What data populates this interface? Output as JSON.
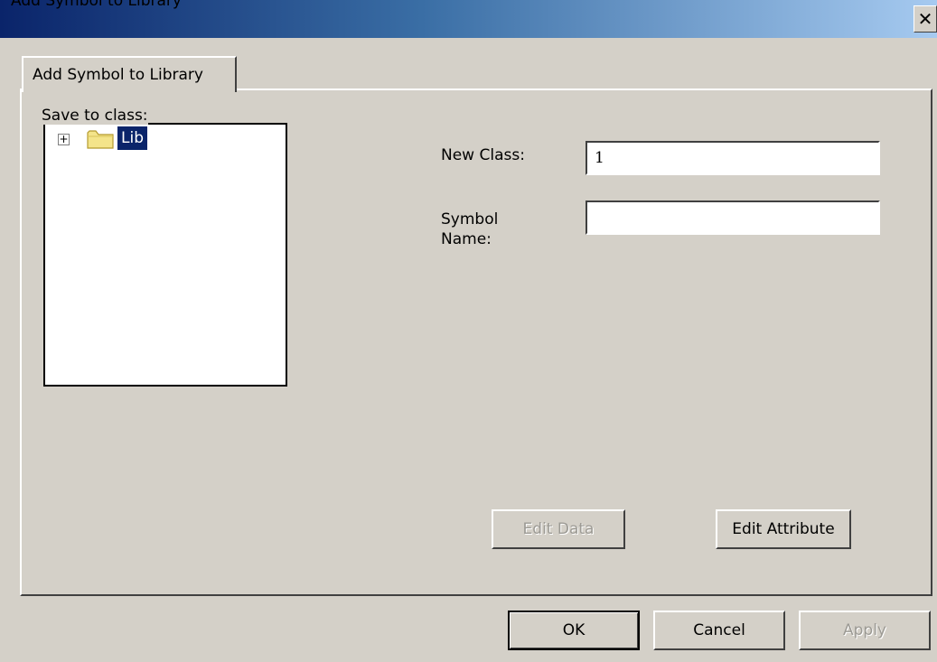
{
  "window": {
    "title": "Add Symbol to Library",
    "close_icon": "close-icon"
  },
  "tabs": [
    {
      "label": "Add Symbol to Library",
      "active": true
    }
  ],
  "tree_group": {
    "label": "Save to class:",
    "nodes": [
      {
        "label": "Lib",
        "expander": "+",
        "icon": "folder-icon",
        "selected": true
      }
    ]
  },
  "form": {
    "new_class_label": "New Class:",
    "new_class_value": "1",
    "symbol_name_label": "Symbol Name:",
    "symbol_name_value": ""
  },
  "buttons": {
    "edit_data": "Edit Data",
    "edit_attribute": "Edit Attribute",
    "ok": "OK",
    "cancel": "Cancel",
    "apply": "Apply"
  },
  "colors": {
    "selection": "#0a246a",
    "dialog_bg": "#d4d0c8",
    "folder": "#f4e48a"
  }
}
